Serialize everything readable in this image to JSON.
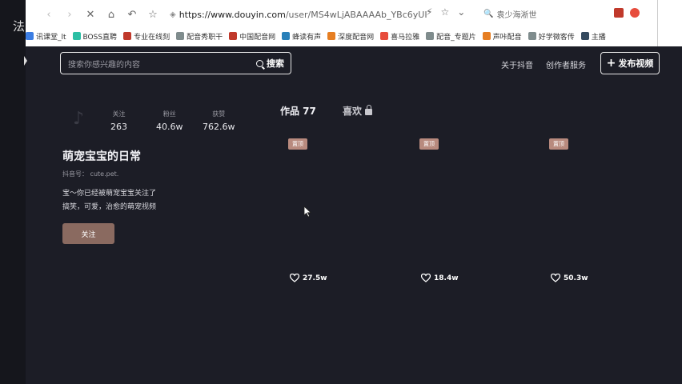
{
  "edge": {
    "text": "法"
  },
  "browser": {
    "url_host": "https://www.douyin.com",
    "url_path": "/user/MS4wLjABAAAAb_YBc6yUI",
    "search_text": "袁少海淅世",
    "bookmarks": [
      {
        "label": "讯课堂_lt",
        "color": "#3b7de3"
      },
      {
        "label": "BOSS直聘",
        "color": "#2cbfa4"
      },
      {
        "label": "专业在线刻",
        "color": "#c0392b"
      },
      {
        "label": "配音秀职干",
        "color": "#7f8c8d"
      },
      {
        "label": "中国配音网",
        "color": "#c0392b"
      },
      {
        "label": "蜂读有声",
        "color": "#2980b9"
      },
      {
        "label": "深度配音网",
        "color": "#e67e22"
      },
      {
        "label": "喜马拉雅",
        "color": "#e74c3c"
      },
      {
        "label": "配音_专题片",
        "color": "#7f8c8d"
      },
      {
        "label": "声咔配音",
        "color": "#e67e22"
      },
      {
        "label": "好学微客传",
        "color": "#7f8c8d"
      },
      {
        "label": "主播",
        "color": "#34495e"
      }
    ]
  },
  "header": {
    "search_placeholder": "搜索你感兴趣的内容",
    "search_button": "搜索",
    "about": "关于抖音",
    "creator": "创作者服务",
    "publish": "发布视频"
  },
  "profile": {
    "stats": [
      {
        "label": "关注",
        "value": "263"
      },
      {
        "label": "粉丝",
        "value": "40.6w"
      },
      {
        "label": "获赞",
        "value": "762.6w"
      }
    ],
    "name": "萌宠宝宝的日常",
    "douyin_id": "抖音号： cute.pet.",
    "bio_line1": "宝～你已经被萌宠宝宝关注了",
    "bio_line2": "搞笑，可爱，治愈的萌宠视频",
    "follow_button": "关注"
  },
  "tabs": {
    "works": "作品 77",
    "likes": "喜欢"
  },
  "videos": [
    {
      "tag": "置顶",
      "likes": "27.5w"
    },
    {
      "tag": "置顶",
      "likes": "18.4w"
    },
    {
      "tag": "置顶",
      "likes": "50.3w"
    }
  ]
}
